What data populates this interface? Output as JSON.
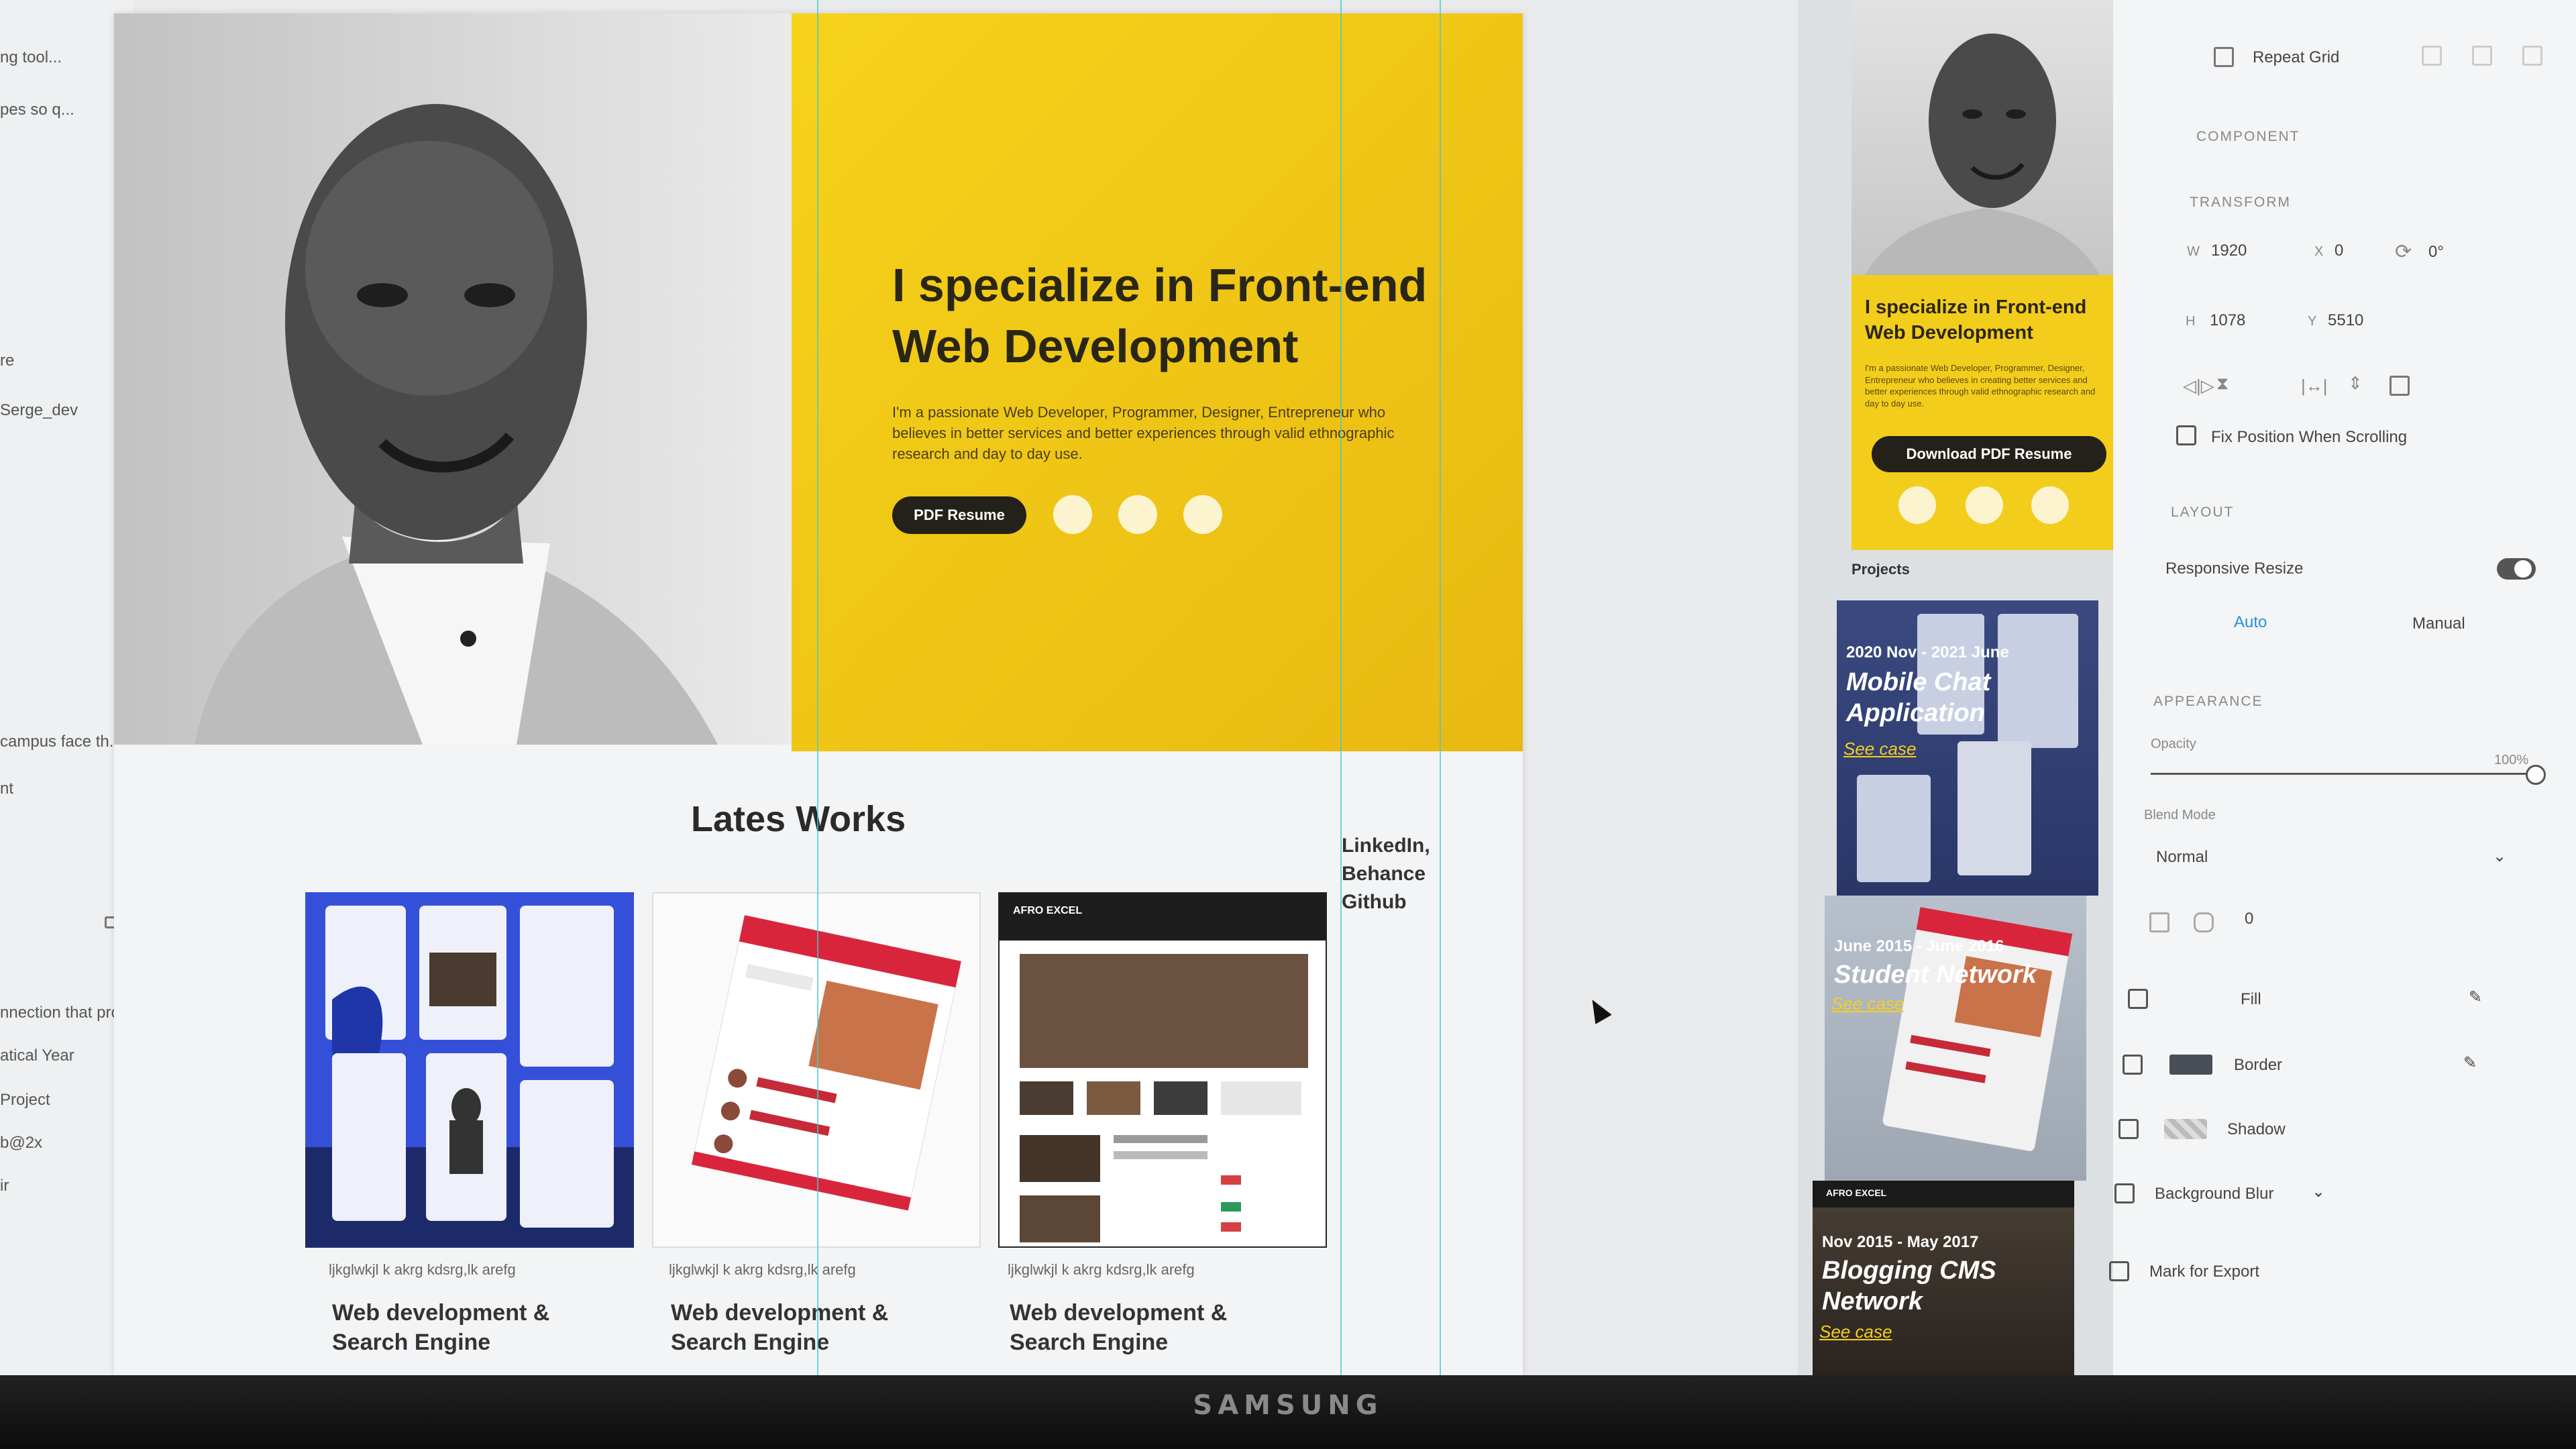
{
  "app": {
    "monitor_brand": "SAMSUNG"
  },
  "layers_panel": {
    "items": [
      "ng tool...",
      "pes so q...",
      "re",
      "Serge_dev",
      "campus face th...",
      "nt",
      "nnection that pro...",
      "atical Year",
      "Project",
      "b@2x",
      "ir"
    ]
  },
  "hero": {
    "headline": "I specialize in Front-end Web Development",
    "paragraph": "I'm a passionate Web Developer, Programmer, Designer, Entrepreneur who believes in better services and better experiences through valid ethnographic research and day to day use.",
    "pdf_button": "PDF Resume"
  },
  "works": {
    "title": "Lates Works",
    "links": [
      "LinkedIn,",
      "Behance",
      "Github"
    ],
    "cards": [
      {
        "subtitle": "ljkglwkjl k akrg kdsrg,lk arefg",
        "title": "Web development & Search Engine"
      },
      {
        "subtitle": "ljkglwkjl k akrg kdsrg,lk arefg",
        "title": "Web development & Search Engine"
      },
      {
        "subtitle": "ljkglwkjl k akrg kdsrg,lk arefg",
        "title": "Web development & Search Engine"
      }
    ],
    "card3_header": "AFRO EXCEL"
  },
  "preview": {
    "headline": "I specialize in Front-end Web Development",
    "paragraph": "I'm a passionate Web Developer, Programmer, Designer, Entrepreneur who believes in creating better services and better experiences through valid ethnographic research and day to day use.",
    "download_button": "Download PDF Resume",
    "projects_label": "Projects",
    "projects": [
      {
        "date": "2020 Nov - 2021 June",
        "title": "Mobile Chat Application",
        "link": "See case"
      },
      {
        "date": "June 2015 - June 2016",
        "title": "Student Network",
        "link": "See case"
      },
      {
        "date": "Nov 2015 - May 2017",
        "title": "Blogging CMS Network",
        "link": "See case"
      }
    ],
    "projects_separator_label": "AFRO EXCEL"
  },
  "properties": {
    "repeat_grid": "Repeat Grid",
    "component_label": "COMPONENT",
    "transform_label": "TRANSFORM",
    "w_label": "W",
    "w_value": "1920",
    "x_label": "X",
    "x_value": "0",
    "rotation_value": "0°",
    "h_label": "H",
    "h_value": "1078",
    "y_label": "Y",
    "y_value": "5510",
    "fix_position": "Fix Position When Scrolling",
    "layout_label": "LAYOUT",
    "responsive_resize": "Responsive Resize",
    "responsive_resize_on": true,
    "auto": "Auto",
    "manual": "Manual",
    "appearance_label": "APPEARANCE",
    "opacity_label": "Opacity",
    "opacity_value": "100%",
    "blend_mode_label": "Blend Mode",
    "blend_mode_value": "Normal",
    "corner_radius_value": "0",
    "fill": "Fill",
    "border": "Border",
    "shadow": "Shadow",
    "background_blur": "Background Blur",
    "mark_for_export": "Mark for Export"
  },
  "colors": {
    "hero_yellow": "#f6d31a",
    "button_dark": "#23211a",
    "link_yellow": "#f5d01a",
    "accent_auto": "#2a8fd8"
  }
}
